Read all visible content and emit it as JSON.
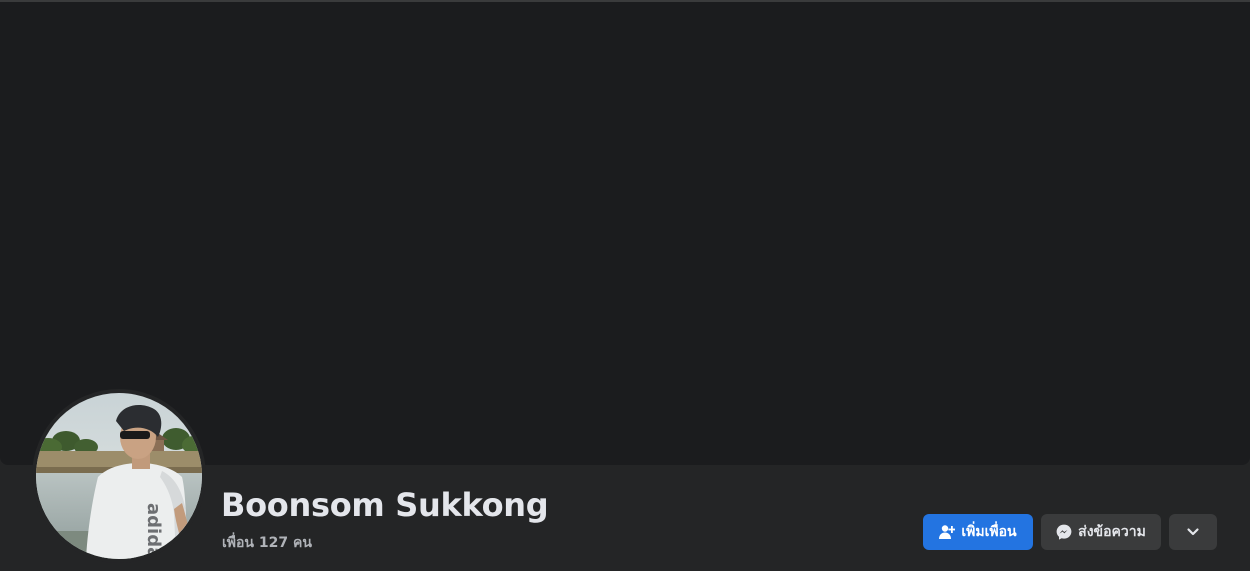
{
  "profile": {
    "name": "Boonsom Sukkong",
    "friends_text": "เพื่อน 127 คน"
  },
  "actions": {
    "add_friend_label": "เพิ่มเพื่อน",
    "message_label": "ส่งข้อความ"
  },
  "icons": {
    "add_friend": "add-friend-icon",
    "messenger": "messenger-icon",
    "more": "chevron-down-icon"
  },
  "colors": {
    "page_background": "#242526",
    "cover_background": "#1b1c1e",
    "primary_button": "#2374e1",
    "secondary_button": "#3a3b3c",
    "primary_text": "#e4e6eb",
    "secondary_text": "#b0b3b8"
  }
}
